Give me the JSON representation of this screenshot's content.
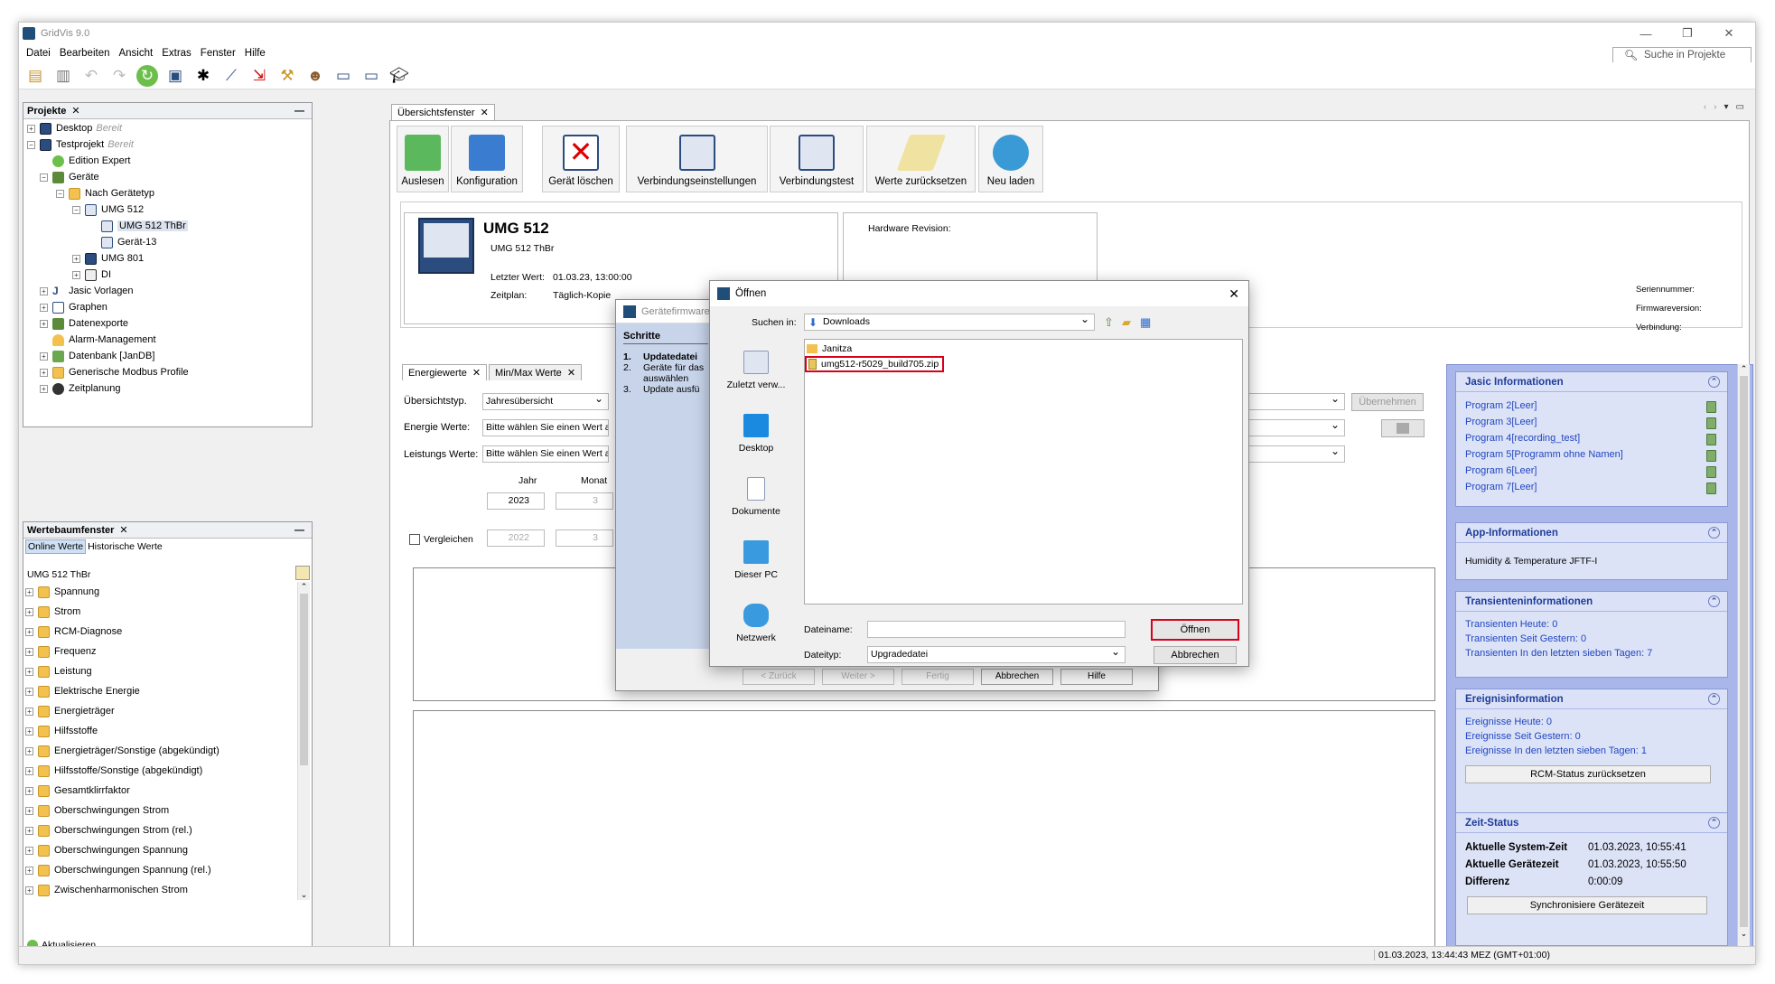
{
  "app": {
    "title": "GridVis 9.0",
    "search_placeholder": "Suche in Projekte (Ctrl+I)"
  },
  "window_buttons": {
    "minimize": "—",
    "maximize": "❐",
    "close": "✕"
  },
  "menu": [
    "Datei",
    "Bearbeiten",
    "Ansicht",
    "Extras",
    "Fenster",
    "Hilfe"
  ],
  "projects_panel": {
    "title": "Projekte",
    "items": [
      {
        "label": "Desktop",
        "status": "Bereit"
      },
      {
        "label": "Testprojekt",
        "status": "Bereit"
      },
      {
        "label": "Edition Expert"
      },
      {
        "label": "Geräte"
      },
      {
        "label": "Nach Gerätetyp"
      },
      {
        "label": "UMG 512"
      },
      {
        "label": "UMG  512 ThBr"
      },
      {
        "label": "Gerät-13"
      },
      {
        "label": "UMG 801"
      },
      {
        "label": "DI"
      },
      {
        "label": "Jasic Vorlagen"
      },
      {
        "label": "Graphen"
      },
      {
        "label": "Datenexporte"
      },
      {
        "label": "Alarm-Management"
      },
      {
        "label": "Datenbank [JanDB]"
      },
      {
        "label": "Generische Modbus Profile"
      },
      {
        "label": "Zeitplanung"
      }
    ]
  },
  "value_tree_panel": {
    "title": "Wertebaumfenster",
    "tabs": [
      "Online Werte",
      "Historische Werte"
    ],
    "device": "UMG  512 ThBr",
    "items": [
      "Spannung",
      "Strom",
      "RCM-Diagnose",
      "Frequenz",
      "Leistung",
      "Elektrische Energie",
      "Energieträger",
      "Hilfsstoffe",
      "Energieträger/Sonstige (abgekündigt)",
      "Hilfsstoffe/Sonstige (abgekündigt)",
      "Gesamtklirrfaktor",
      "Oberschwingungen Strom",
      "Oberschwingungen Strom (rel.)",
      "Oberschwingungen Spannung",
      "Oberschwingungen Spannung (rel.)",
      "Zwischenharmonischen Strom"
    ],
    "refresh": "Aktualisieren"
  },
  "overview": {
    "tab": "Übersichtsfenster",
    "buttons": [
      "Auslesen",
      "Konfiguration",
      "Gerät löschen",
      "Verbindungseinstellungen",
      "Verbindungstest",
      "Werte zurücksetzen",
      "Neu laden"
    ],
    "device_name": "UMG 512",
    "device_sub": "UMG  512 ThBr",
    "last_value_label": "Letzter Wert:",
    "last_value": "01.03.23, 13:00:00",
    "schedule_label": "Zeitplan:",
    "schedule": "Täglich-Kopie",
    "hw_revision": "Hardware Revision:",
    "right_labels": [
      "Seriennummer:",
      "Firmwareversion:",
      "Verbindung:"
    ]
  },
  "energy": {
    "tabs": [
      "Energiewerte",
      "Min/Max Werte"
    ],
    "overview_type_label": "Übersichtstyp.",
    "overview_type": "Jahresübersicht",
    "energy_label": "Energie Werte:",
    "energy_placeholder": "Bitte wählen Sie einen Wert aus",
    "power_label": "Leistungs Werte:",
    "power_placeholder": "Bitte wählen Sie einen Wert aus",
    "year_label": "Jahr",
    "month_label": "Monat",
    "year": "2023",
    "month": "3",
    "compare_label": "Vergleichen",
    "compare_year": "2022",
    "compare_month": "3",
    "apply": "Übernehmen"
  },
  "firmware_wizard": {
    "title": "Gerätefirmware",
    "steps_header": "Schritte",
    "steps": [
      "Updatedatei",
      "Geräte für das",
      "auswählen",
      "Update ausfü"
    ],
    "step_numbers": [
      "1.",
      "2.",
      "3."
    ],
    "buttons": [
      "< Zurück",
      "Weiter >",
      "Fertig",
      "Abbrechen",
      "Hilfe"
    ]
  },
  "open_dialog": {
    "title": "Öffnen",
    "look_in_label": "Suchen in:",
    "look_in": "Downloads",
    "places": [
      "Zuletzt verw...",
      "Desktop",
      "Dokumente",
      "Dieser PC",
      "Netzwerk"
    ],
    "files": [
      {
        "name": "Janitza",
        "type": "folder"
      },
      {
        "name": "umg512-r5029_build705.zip",
        "type": "zip"
      }
    ],
    "filename_label": "Dateiname:",
    "filename": "",
    "filetype_label": "Dateityp:",
    "filetype": "Upgradedatei",
    "open": "Öffnen",
    "cancel": "Abbrechen"
  },
  "right_panels": {
    "jasic": {
      "title": "Jasic Informationen",
      "programs": [
        "Program 2[Leer]",
        "Program 3[Leer]",
        "Program 4[recording_test]",
        "Program 5[Programm ohne Namen]",
        "Program 6[Leer]",
        "Program 7[Leer]"
      ]
    },
    "app": {
      "title": "App-Informationen",
      "text": "Humidity & Temperature JFTF-I"
    },
    "transients": {
      "title": "Transienteninformationen",
      "lines": [
        "Transienten Heute: 0",
        "Transienten Seit Gestern: 0",
        "Transienten In den letzten sieben Tagen: 7"
      ]
    },
    "events": {
      "title": "Ereignisinformation",
      "lines": [
        "Ereignisse Heute: 0",
        "Ereignisse Seit Gestern: 0",
        "Ereignisse In den letzten sieben Tagen: 1"
      ],
      "button": "RCM-Status zurücksetzen"
    },
    "time": {
      "title": "Zeit-Status",
      "rows": [
        {
          "label": "Aktuelle System-Zeit",
          "value": "01.03.2023, 10:55:41"
        },
        {
          "label": "Aktuelle Gerätezeit",
          "value": "01.03.2023, 10:55:50"
        },
        {
          "label": "Differenz",
          "value": "0:00:09"
        }
      ],
      "button": "Synchronisiere Gerätezeit"
    }
  },
  "status_bar": {
    "text": "01.03.2023, 13:44:43 MEZ (GMT+01:00)"
  }
}
